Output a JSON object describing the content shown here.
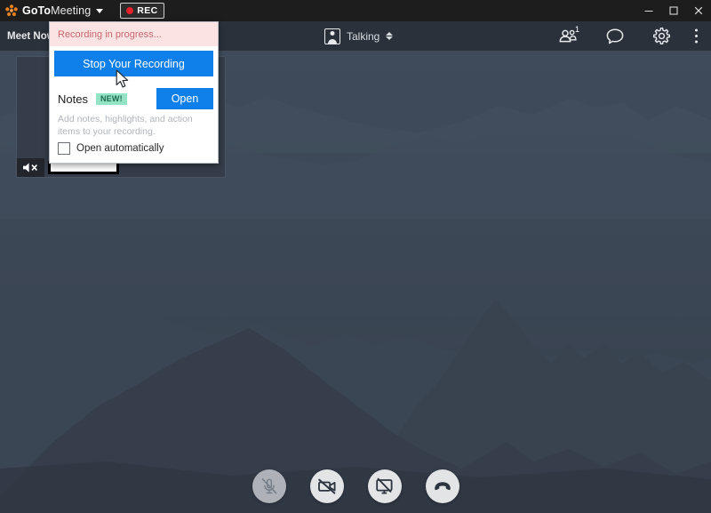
{
  "app": {
    "brand_bold": "GoTo",
    "brand_light": "Meeting",
    "logo_color": "#e8801e",
    "accent_blue": "#0f7fea",
    "rec_red": "#e8202a",
    "new_badge_bg": "#93e3c4"
  },
  "titlebar": {
    "rec_label": "REC",
    "minimize": "Minimize",
    "maximize": "Maximize",
    "close": "Close"
  },
  "toolbar": {
    "meet_now": "Meet Now",
    "talking_label": "Talking",
    "participants_count": "1",
    "chat_label": "Chat",
    "settings_label": "Settings",
    "more_label": "More options"
  },
  "video_tile": {
    "name_label": "",
    "muted": true
  },
  "popup": {
    "banner_text": "Recording in progress...",
    "stop_button": "Stop Your Recording",
    "notes_title": "Notes",
    "new_badge": "NEW!",
    "open_button": "Open",
    "description": "Add notes, highlights, and action items to your recording.",
    "checkbox_label": "Open automatically",
    "checkbox_checked": false
  },
  "controls": {
    "mic": "Unmute microphone",
    "camera": "Turn on camera",
    "screen": "Share screen",
    "leave": "Leave meeting"
  }
}
